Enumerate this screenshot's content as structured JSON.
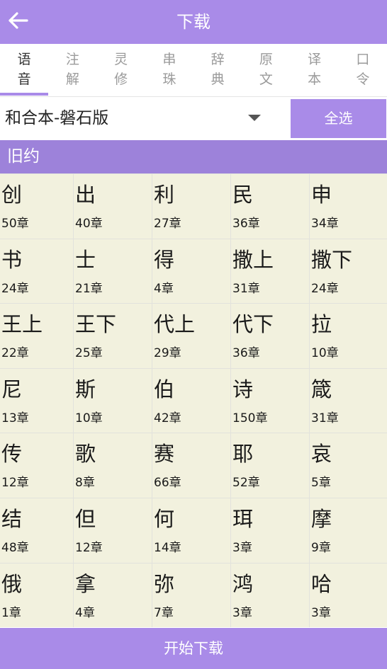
{
  "header": {
    "title": "下载",
    "back_icon": "arrow-left-icon"
  },
  "tabs": [
    {
      "line1": "语",
      "line2": "音",
      "active": true
    },
    {
      "line1": "注",
      "line2": "解",
      "active": false
    },
    {
      "line1": "灵",
      "line2": "修",
      "active": false
    },
    {
      "line1": "串",
      "line2": "珠",
      "active": false
    },
    {
      "line1": "辞",
      "line2": "典",
      "active": false
    },
    {
      "line1": "原",
      "line2": "文",
      "active": false
    },
    {
      "line1": "译",
      "line2": "本",
      "active": false
    },
    {
      "line1": "口",
      "line2": "令",
      "active": false
    }
  ],
  "version_select": {
    "value": "和合本-磐石版",
    "arrow_icon": "dropdown-arrow-icon"
  },
  "select_all_label": "全选",
  "section_title": "旧约",
  "books": [
    {
      "name": "创",
      "chapters": "50章"
    },
    {
      "name": "出",
      "chapters": "40章"
    },
    {
      "name": "利",
      "chapters": "27章"
    },
    {
      "name": "民",
      "chapters": "36章"
    },
    {
      "name": "申",
      "chapters": "34章"
    },
    {
      "name": "书",
      "chapters": "24章"
    },
    {
      "name": "士",
      "chapters": "21章"
    },
    {
      "name": "得",
      "chapters": "4章"
    },
    {
      "name": "撒上",
      "chapters": "31章"
    },
    {
      "name": "撒下",
      "chapters": "24章"
    },
    {
      "name": "王上",
      "chapters": "22章"
    },
    {
      "name": "王下",
      "chapters": "25章"
    },
    {
      "name": "代上",
      "chapters": "29章"
    },
    {
      "name": "代下",
      "chapters": "36章"
    },
    {
      "name": "拉",
      "chapters": "10章"
    },
    {
      "name": "尼",
      "chapters": "13章"
    },
    {
      "name": "斯",
      "chapters": "10章"
    },
    {
      "name": "伯",
      "chapters": "42章"
    },
    {
      "name": "诗",
      "chapters": "150章"
    },
    {
      "name": "箴",
      "chapters": "31章"
    },
    {
      "name": "传",
      "chapters": "12章"
    },
    {
      "name": "歌",
      "chapters": "8章"
    },
    {
      "name": "赛",
      "chapters": "66章"
    },
    {
      "name": "耶",
      "chapters": "52章"
    },
    {
      "name": "哀",
      "chapters": "5章"
    },
    {
      "name": "结",
      "chapters": "48章"
    },
    {
      "name": "但",
      "chapters": "12章"
    },
    {
      "name": "何",
      "chapters": "14章"
    },
    {
      "name": "珥",
      "chapters": "3章"
    },
    {
      "name": "摩",
      "chapters": "9章"
    },
    {
      "name": "俄",
      "chapters": "1章"
    },
    {
      "name": "拿",
      "chapters": "4章"
    },
    {
      "name": "弥",
      "chapters": "7章"
    },
    {
      "name": "鸿",
      "chapters": "3章"
    },
    {
      "name": "哈",
      "chapters": "3章"
    }
  ],
  "start_download_label": "开始下载",
  "colors": {
    "accent": "#a98be8",
    "section": "#9d82da",
    "cell_bg": "#f2f1de"
  }
}
